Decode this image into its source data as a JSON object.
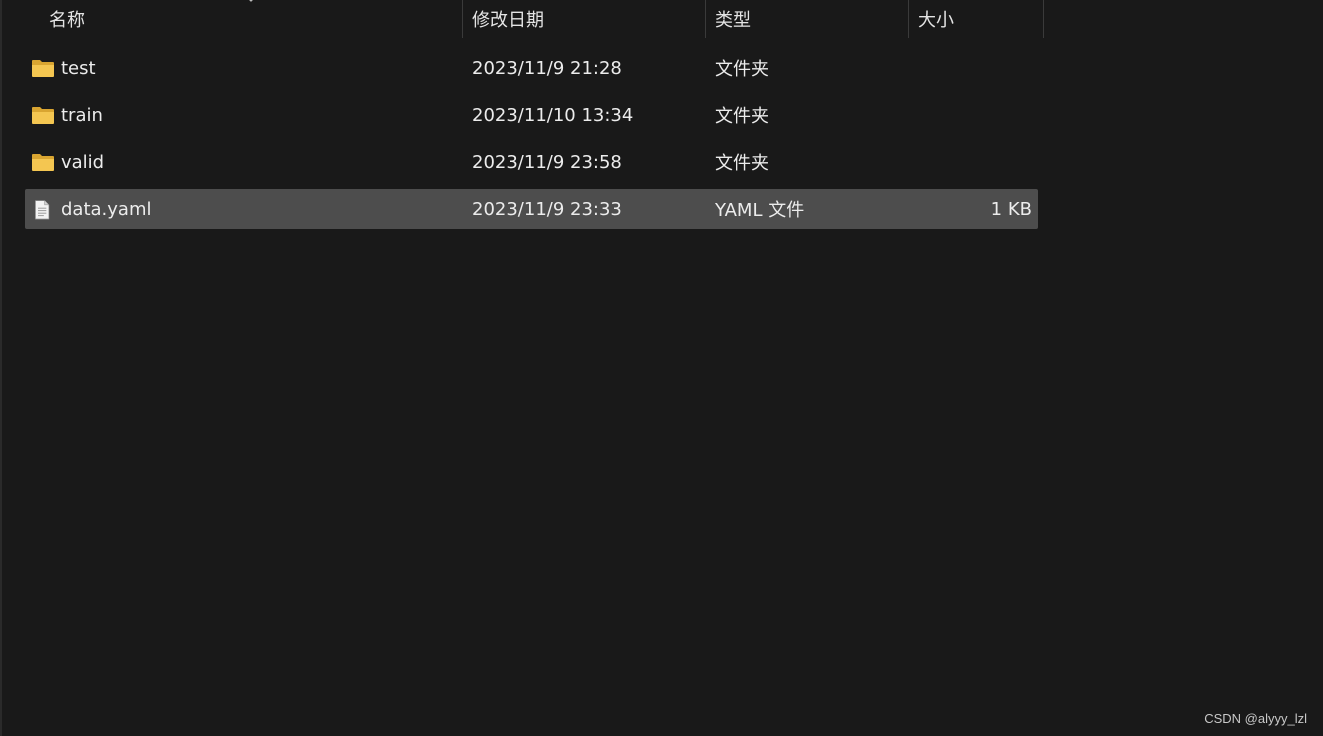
{
  "columns": {
    "name": "名称",
    "modified": "修改日期",
    "type": "类型",
    "size": "大小"
  },
  "files": [
    {
      "name": "test",
      "modified": "2023/11/9 21:28",
      "type": "文件夹",
      "size": "",
      "icon": "folder-icon",
      "selected": false
    },
    {
      "name": "train",
      "modified": "2023/11/10 13:34",
      "type": "文件夹",
      "size": "",
      "icon": "folder-icon",
      "selected": false
    },
    {
      "name": "valid",
      "modified": "2023/11/9 23:58",
      "type": "文件夹",
      "size": "",
      "icon": "folder-icon",
      "selected": false
    },
    {
      "name": "data.yaml",
      "modified": "2023/11/9 23:33",
      "type": "YAML 文件",
      "size": "1 KB",
      "icon": "document-icon",
      "selected": true
    }
  ],
  "watermark": "CSDN @alyyy_lzl",
  "colors": {
    "background": "#191919",
    "selected_row": "#4d4d4d",
    "folder": "#f2c14e"
  }
}
